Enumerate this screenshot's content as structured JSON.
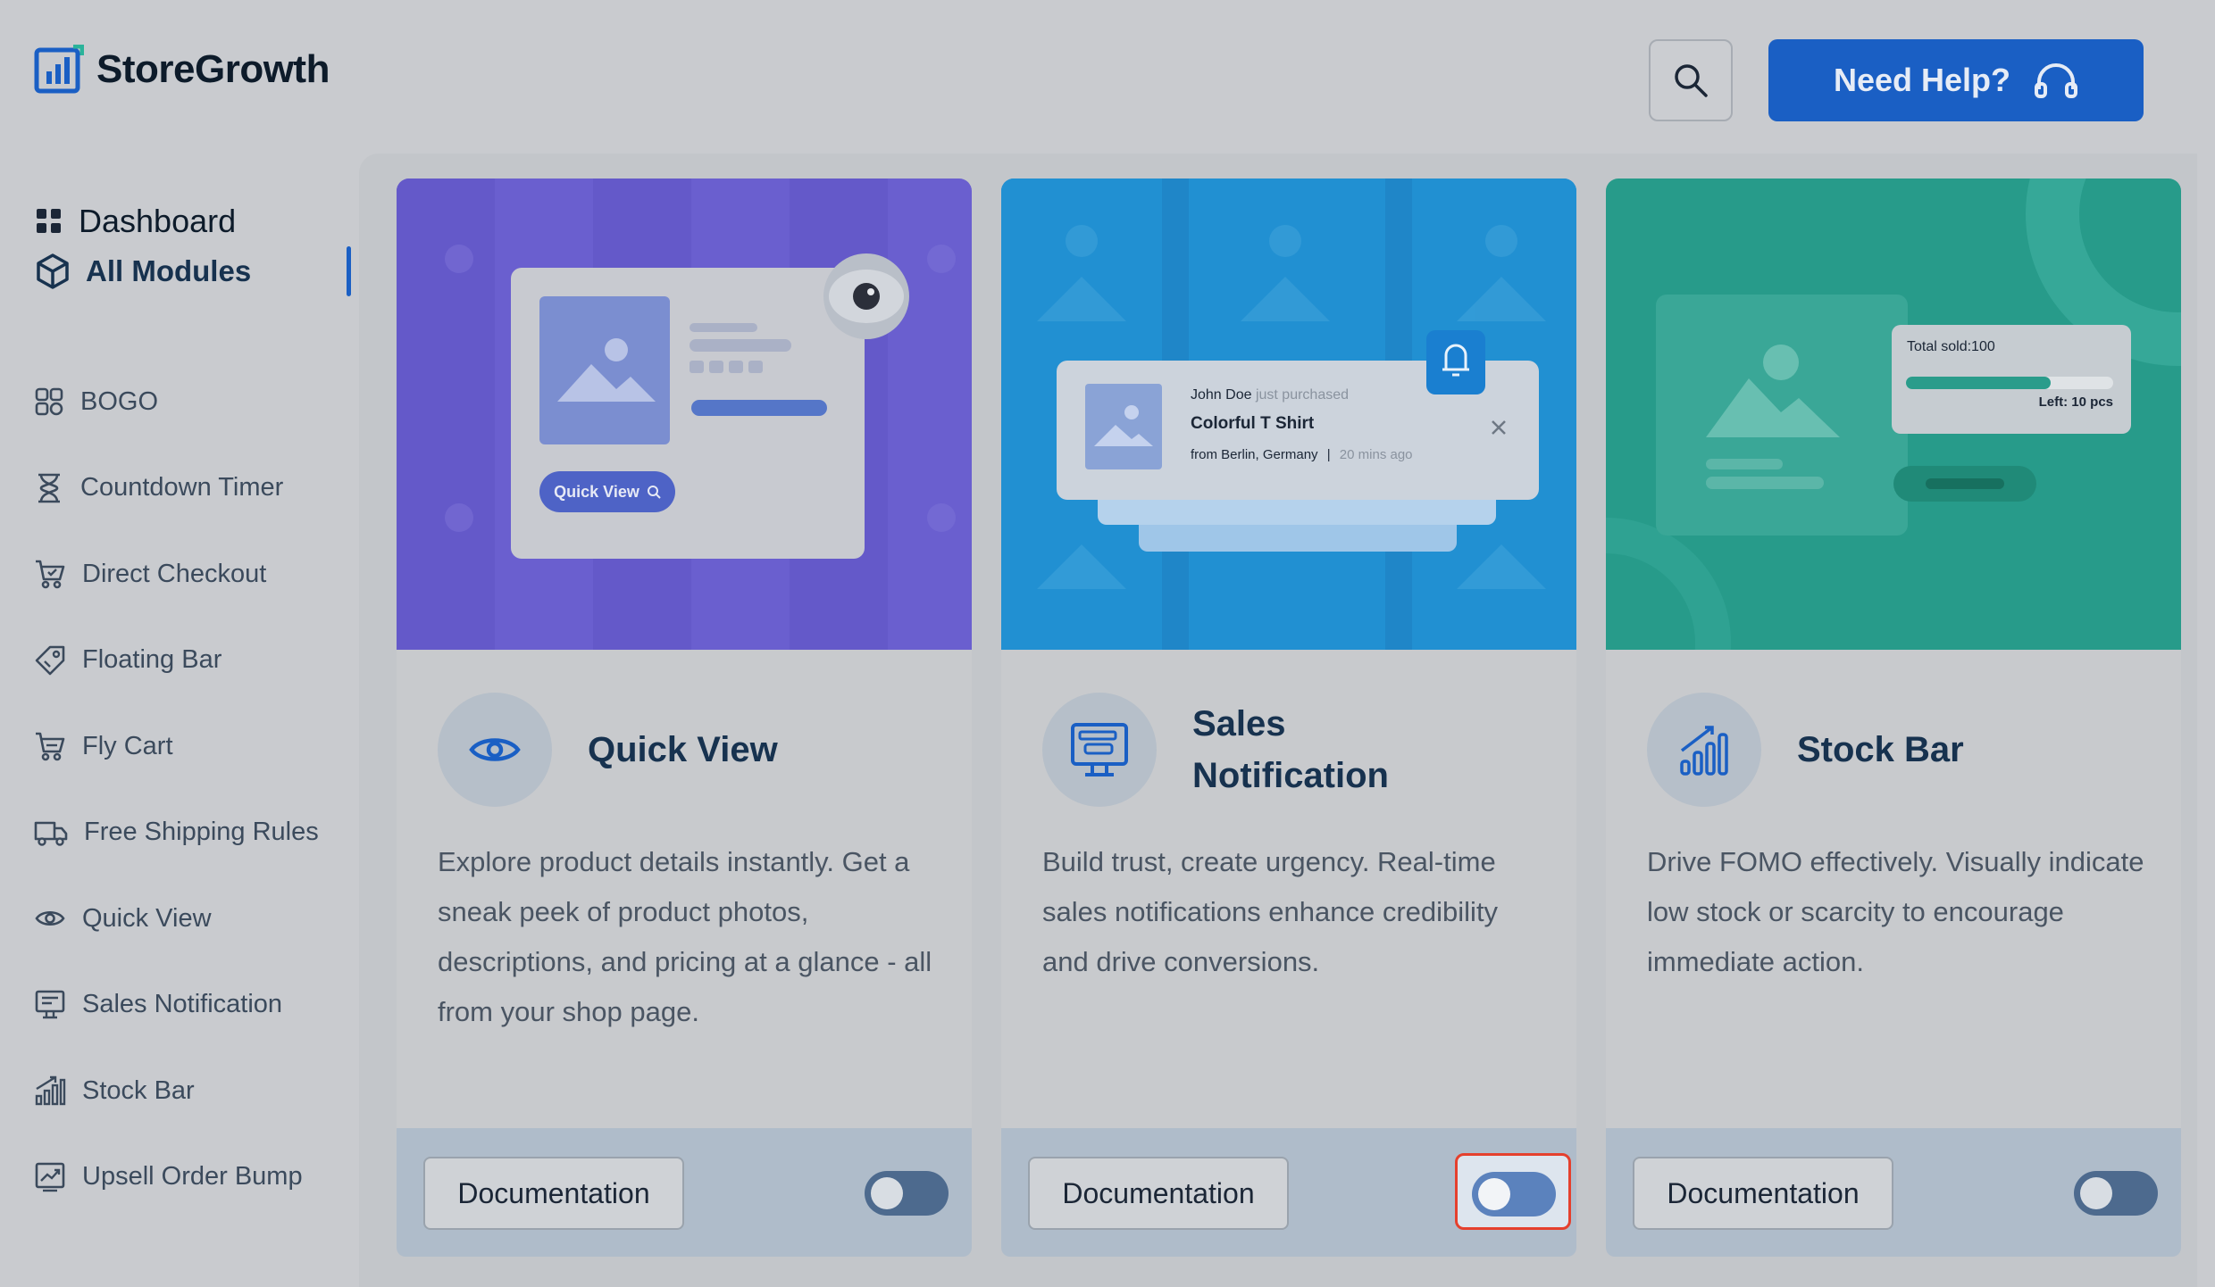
{
  "header": {
    "brand": "StoreGrowth",
    "help_label": "Need Help?"
  },
  "sidebar": {
    "dashboard_label": "Dashboard",
    "all_modules_label": "All Modules",
    "items": [
      {
        "label": "BOGO",
        "icon": "bogo-icon"
      },
      {
        "label": "Countdown Timer",
        "icon": "hourglass-icon"
      },
      {
        "label": "Direct Checkout",
        "icon": "cart-icon"
      },
      {
        "label": "Floating Bar",
        "icon": "tag-icon"
      },
      {
        "label": "Fly Cart",
        "icon": "fly-cart-icon"
      },
      {
        "label": "Free Shipping Rules",
        "icon": "truck-icon"
      },
      {
        "label": "Quick View",
        "icon": "eye-icon"
      },
      {
        "label": "Sales Notification",
        "icon": "notification-icon"
      },
      {
        "label": "Stock Bar",
        "icon": "bar-chart-icon"
      },
      {
        "label": "Upsell Order Bump",
        "icon": "trend-icon"
      }
    ]
  },
  "cards": [
    {
      "title": "Quick View",
      "description": "Explore product details instantly. Get a sneak peek of product photos, descriptions, and pricing at a glance - all from your shop page.",
      "doc_label": "Documentation",
      "enabled": false,
      "banner": {
        "button_label": "Quick View"
      }
    },
    {
      "title_line1": "Sales",
      "title_line2": "Notification",
      "description": "Build trust, create urgency. Real-time sales notifications enhance credibility and drive conversions.",
      "doc_label": "Documentation",
      "enabled": false,
      "focused": true,
      "banner": {
        "name": "John Doe",
        "action": "just purchased",
        "product": "Colorful T Shirt",
        "location": "from Berlin, Germany",
        "separator": "|",
        "time": "20 mins ago"
      }
    },
    {
      "title": "Stock Bar",
      "description": "Drive FOMO effectively. Visually indicate low stock or scarcity to encourage immediate action.",
      "doc_label": "Documentation",
      "enabled": false,
      "banner": {
        "sold_label": "Total sold:100",
        "left_label": "Left: 10 pcs",
        "sold_fraction": 0.7
      }
    }
  ],
  "colors": {
    "accent": "#1a5fc4",
    "quick_view_banner": "#6a5fcf",
    "sales_banner": "#1f86c8",
    "stock_banner": "#279b8a",
    "focus_ring": "#e5402d"
  }
}
